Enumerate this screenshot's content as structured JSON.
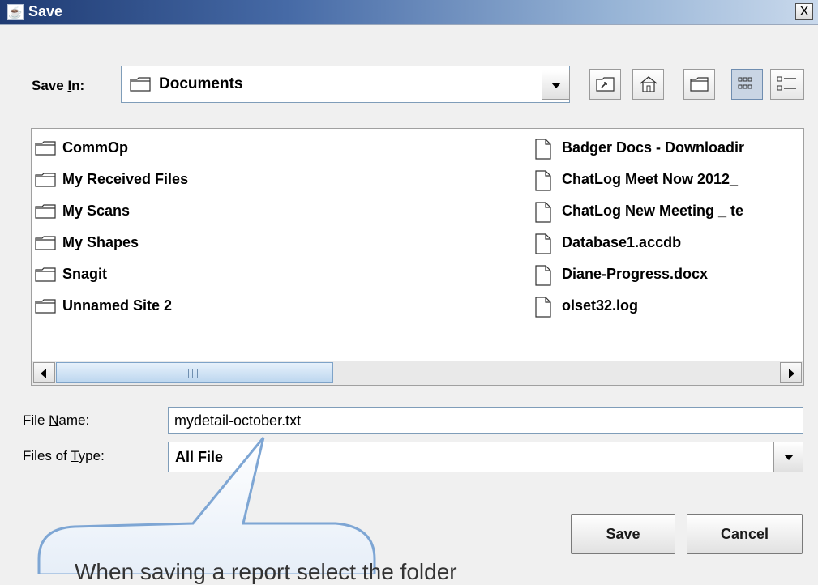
{
  "window": {
    "title": "Save",
    "close_label": "X"
  },
  "save_in": {
    "label_pre": "Save ",
    "label_key": "I",
    "label_post": "n:",
    "value": "Documents"
  },
  "toolbar": {
    "up_icon": "up-one-level-icon",
    "home_icon": "home-icon",
    "new_folder_icon": "new-folder-icon",
    "list_icon": "list-view-icon",
    "details_icon": "details-view-icon"
  },
  "files": {
    "folders": [
      "CommOp",
      "My Received Files",
      "My Scans",
      "My Shapes",
      "Snagit",
      "Unnamed Site 2"
    ],
    "documents": [
      "Badger Docs - Downloadir",
      "ChatLog Meet Now 2012_",
      "ChatLog New Meeting _ te",
      "Database1.accdb",
      "Diane-Progress.docx",
      "olset32.log"
    ]
  },
  "file_name": {
    "label_pre": "File ",
    "label_key": "N",
    "label_post": "ame:",
    "value": "mydetail-october.txt"
  },
  "file_type": {
    "label_pre": "Files of ",
    "label_key": "T",
    "label_post": "ype:",
    "value": "All File"
  },
  "buttons": {
    "save": "Save",
    "cancel": "Cancel"
  },
  "callout": {
    "text": "When saving a report select the folder"
  },
  "colors": {
    "title_start": "#1f3b73",
    "title_end": "#c9d9ec",
    "field_border": "#7f9db9"
  }
}
